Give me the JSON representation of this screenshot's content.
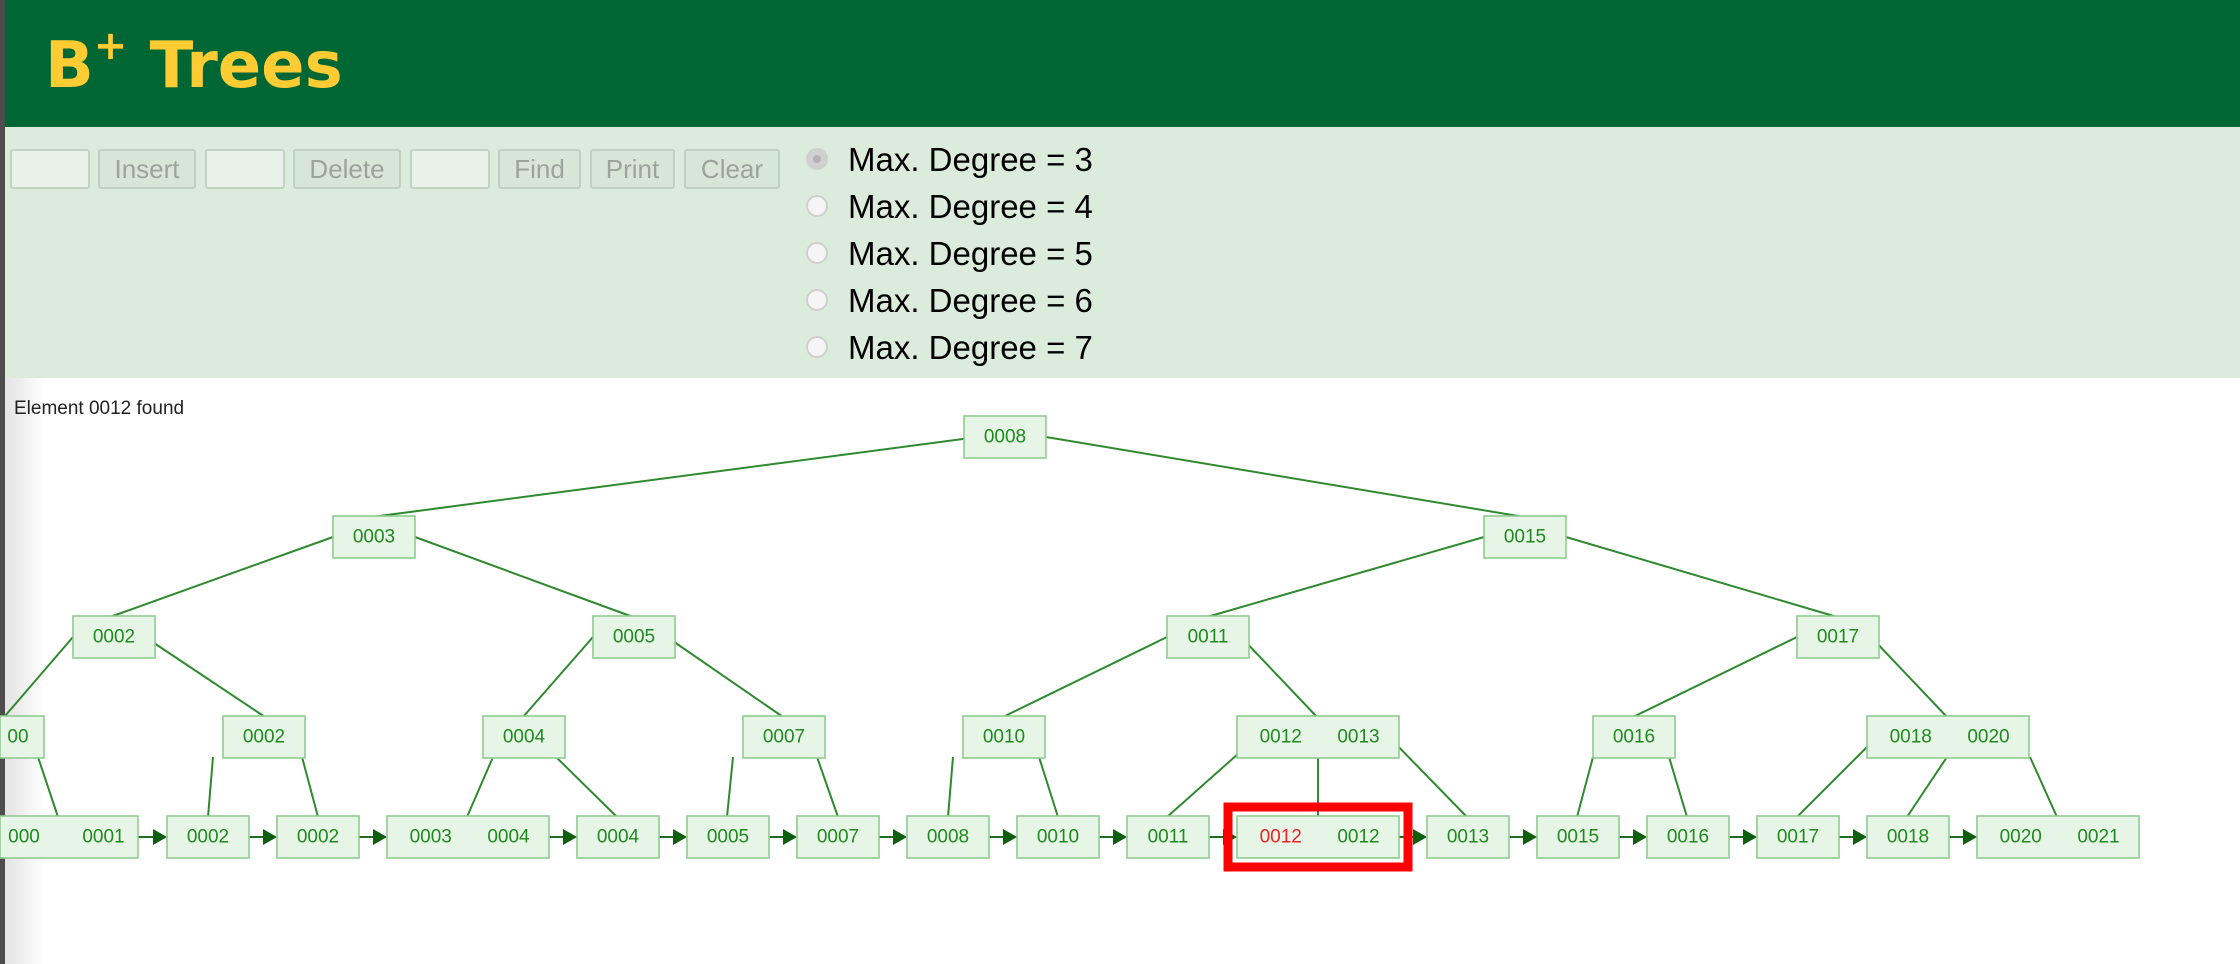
{
  "app": {
    "title_main": "B",
    "title_sup": "+",
    "title_rest": " Trees"
  },
  "controls": {
    "insert_value": "",
    "insert_label": "Insert",
    "delete_value": "",
    "delete_label": "Delete",
    "find_value": "",
    "find_label": "Find",
    "print_label": "Print",
    "clear_label": "Clear",
    "degree_options": [
      "Max. Degree = 3",
      "Max. Degree = 4",
      "Max. Degree = 5",
      "Max. Degree = 6",
      "Max. Degree = 7"
    ],
    "selected_degree_index": 0
  },
  "status": {
    "message": "Element 0012 found"
  },
  "colors": {
    "header_bg": "#006633",
    "title_color": "#ffcc33",
    "controls_bg": "#dcecdc",
    "node_text": "#1f8a1f",
    "found_text": "#ee2222",
    "highlight": "#ff0000"
  },
  "tree": {
    "nodes": [
      {
        "id": "root",
        "keys": [
          "0008"
        ]
      },
      {
        "id": "l1a",
        "keys": [
          "0003"
        ]
      },
      {
        "id": "l1b",
        "keys": [
          "0015"
        ]
      },
      {
        "id": "l2a",
        "keys": [
          "0002"
        ]
      },
      {
        "id": "l2b",
        "keys": [
          "0005"
        ]
      },
      {
        "id": "l2c",
        "keys": [
          "0011"
        ]
      },
      {
        "id": "l2d",
        "keys": [
          "0017"
        ]
      },
      {
        "id": "l3a",
        "keys": [
          "00"
        ]
      },
      {
        "id": "l3b",
        "keys": [
          "0002"
        ]
      },
      {
        "id": "l3c",
        "keys": [
          "0004"
        ]
      },
      {
        "id": "l3d",
        "keys": [
          "0007"
        ]
      },
      {
        "id": "l3e",
        "keys": [
          "0010"
        ]
      },
      {
        "id": "l3f",
        "keys": [
          "0012",
          "0013"
        ]
      },
      {
        "id": "l3g",
        "keys": [
          "0016"
        ]
      },
      {
        "id": "l3h",
        "keys": [
          "0018",
          "0020"
        ]
      },
      {
        "id": "f1",
        "keys": [
          "000",
          "0001"
        ]
      },
      {
        "id": "f2",
        "keys": [
          "0002"
        ]
      },
      {
        "id": "f3",
        "keys": [
          "0002"
        ]
      },
      {
        "id": "f4",
        "keys": [
          "0003",
          "0004"
        ]
      },
      {
        "id": "f5",
        "keys": [
          "0004"
        ]
      },
      {
        "id": "f6",
        "keys": [
          "0005"
        ]
      },
      {
        "id": "f7",
        "keys": [
          "0007"
        ]
      },
      {
        "id": "f8",
        "keys": [
          "0008"
        ]
      },
      {
        "id": "f9",
        "keys": [
          "0010"
        ]
      },
      {
        "id": "f10",
        "keys": [
          "0011"
        ]
      },
      {
        "id": "f11",
        "keys": [
          "0012",
          "0012"
        ],
        "found": true
      },
      {
        "id": "f12",
        "keys": [
          "0013"
        ]
      },
      {
        "id": "f13",
        "keys": [
          "0015"
        ]
      },
      {
        "id": "f14",
        "keys": [
          "0016"
        ]
      },
      {
        "id": "f15",
        "keys": [
          "0017"
        ]
      },
      {
        "id": "f16",
        "keys": [
          "0018"
        ]
      },
      {
        "id": "f17",
        "keys": [
          "0020",
          "0021"
        ]
      }
    ]
  }
}
